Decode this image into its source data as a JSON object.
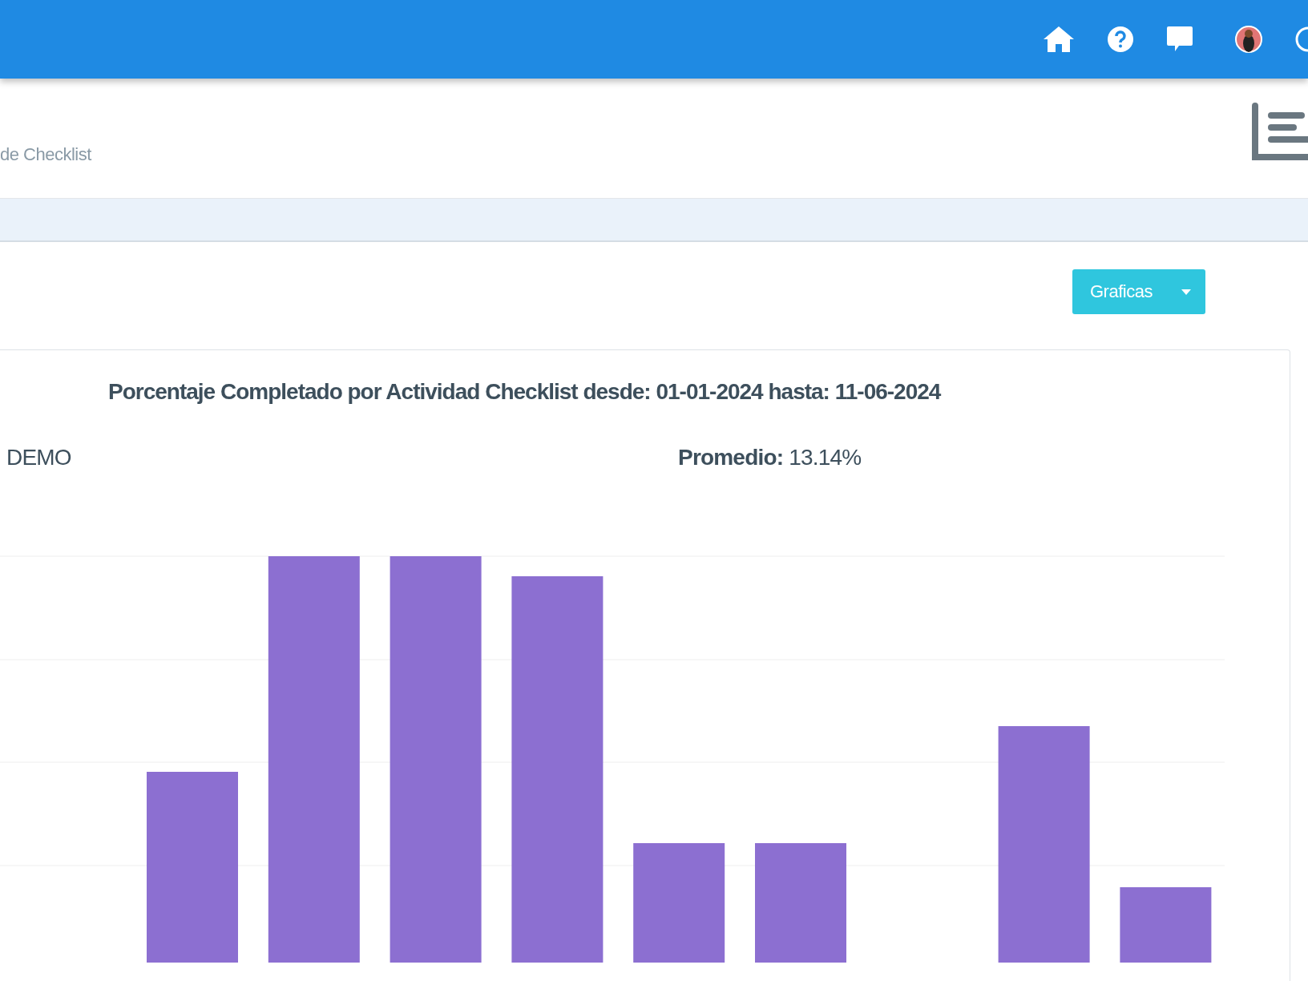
{
  "header": {
    "breadcrumb": "de Checklist"
  },
  "toolbar": {
    "button": "Graficas"
  },
  "card": {
    "title": "Porcentaje Completado por Actividad Checklist desde: 01-01-2024 hasta: 11-06-2024",
    "company": "DEMO",
    "average": "**Promedio:** 13.14%"
  }
}
